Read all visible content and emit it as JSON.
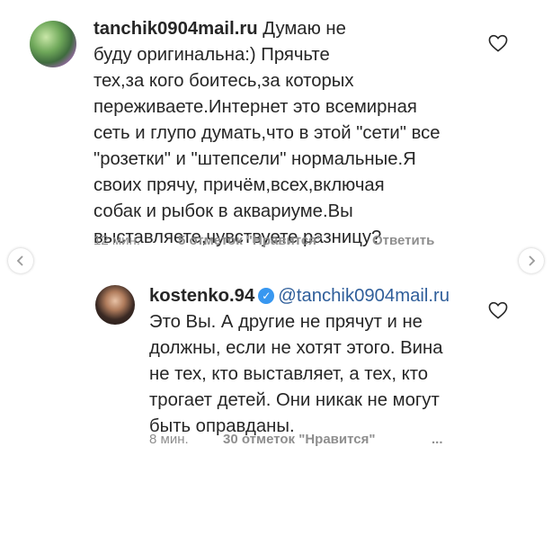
{
  "comments": [
    {
      "username": "tanchik0904mail.ru",
      "text": " Думаю не\nбуду оригинальна:) Прячьте\nтех,за кого боитесь,за которых\nпереживаете.Интернет это всемирная\nсеть и глупо думать,что в этой \"сети\" все\n\"розетки\" и \"штепсели\" нормальные.Я\nсвоих прячу, причём,всех,включая\nсобак и рыбок в аквариуме.Вы\nвыставляете,чувствуете разницу?",
      "time": "12 мин.",
      "likes": "5 отметок \"Нравится\"",
      "reply": "Ответить",
      "avatar_icon": "profile-avatar"
    },
    {
      "username": "kostenko.94",
      "mention": "@tanchik0904mail.ru",
      "text": "\nЭто Вы. А другие не прячут и не\nдолжны, если не хотят этого. Вина\nне тех, кто выставляет, а тех, кто\nтрогает детей. Они никак не могут\nбыть оправданы.",
      "time": "8 мин.",
      "likes": "30 отметок \"Нравится\"",
      "more": "...",
      "verified_icon": "verified-badge",
      "avatar_icon": "profile-avatar"
    }
  ],
  "colors": {
    "text": "#262626",
    "meta": "#8e8e8e",
    "mention": "#2f5e9a",
    "verified": "#3897f0"
  }
}
